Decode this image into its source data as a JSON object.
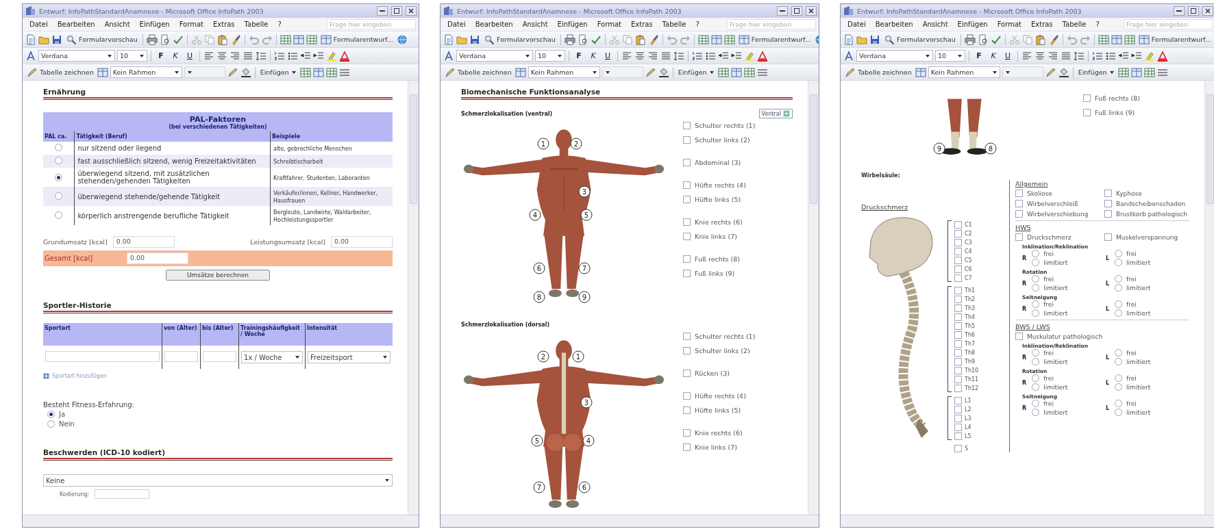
{
  "windows": [
    {
      "title": "Entwurf: InfoPathStandardAnamnese - Microsoft Office InfoPath 2003",
      "menus": [
        "Datei",
        "Bearbeiten",
        "Ansicht",
        "Einfügen",
        "Format",
        "Extras",
        "Tabelle",
        "?"
      ],
      "help_placeholder": "Frage hier eingeben",
      "toolbar": {
        "preview": "Formularvorschau",
        "design": "Formularentwurf...",
        "font": "Verdana",
        "size": "10",
        "format_buttons": [
          "F",
          "K",
          "U"
        ],
        "draw_table": "Tabelle zeichnen",
        "border": "Kein Rahmen",
        "insert": "Einfügen"
      },
      "content": [
        {
          "kind": "heading",
          "text": "Ernährung"
        },
        {
          "kind": "pal_table",
          "title": "PAL-Faktoren",
          "subtitle": "(bei verschiedenen Tätigkeiten)",
          "columns": [
            "PAL ca.",
            "Tätigkeit (Beruf)",
            "Beispiele"
          ],
          "rows": [
            {
              "activity": "nur sitzend oder liegend",
              "examples": "alte, gebrechliche Menschen",
              "selected": false
            },
            {
              "activity": "fast ausschließlich sitzend, wenig Freizeitaktivitäten",
              "examples": "Schreibtischarbeit",
              "selected": false
            },
            {
              "activity": "überwiegend sitzend, mit zusätzlichen stehenden/gehenden Tätigkeiten",
              "examples": "Kraftfahrer, Studenten, Laboranten",
              "selected": true
            },
            {
              "activity": "überwiegend stehende/gehende Tätigkeit",
              "examples": "Verkäufer/innen, Kellner, Handwerker, Hausfrauen",
              "selected": false
            },
            {
              "activity": "körperlich anstrengende berufliche Tätigkeit",
              "examples": "Bergleute, Landwirte, Waldarbeiter, Hochleistungssportler",
              "selected": false
            }
          ]
        },
        {
          "kind": "energy",
          "fields": [
            {
              "label": "Grundumsatz [kcal]",
              "value": "0.00"
            },
            {
              "label": "Leistungsumsatz [kcal]",
              "value": "0.00"
            }
          ],
          "total": {
            "label": "Gesamt [kcal]",
            "value": "0.00"
          },
          "button": "Umsätze berechnen"
        },
        {
          "kind": "heading",
          "text": "Sportler-Historie"
        },
        {
          "kind": "sport_table",
          "columns": [
            "Sportart",
            "von (Alter)",
            "bis (Alter)",
            "Trainingshäufigkeit / Woche",
            "Intensität"
          ],
          "row": {
            "frequency": "1x / Woche",
            "intensity": "Freizeitsport"
          },
          "add_link": "Sportart hinzufügen"
        },
        {
          "kind": "radio_group",
          "label": "Besteht Fitness-Erfahrung:",
          "options": [
            {
              "label": "Ja",
              "selected": true
            },
            {
              "label": "Nein",
              "selected": false
            }
          ]
        },
        {
          "kind": "heading",
          "text": "Beschwerden (ICD-10 kodiert)"
        },
        {
          "kind": "select_block",
          "value": "Keine",
          "code_label": "Kodierung:"
        }
      ]
    },
    {
      "title": "Entwurf: InfoPathStandardAnamnese - Microsoft Office InfoPath 2003",
      "menus": [
        "Datei",
        "Bearbeiten",
        "Ansicht",
        "Einfügen",
        "Format",
        "Extras",
        "Tabelle",
        "?"
      ],
      "help_placeholder": "Frage hier eingeben",
      "toolbar": {
        "preview": "Formularvorschau",
        "design": "Formularentwurf...",
        "font": "Verdana",
        "size": "10",
        "format_buttons": [
          "F",
          "K",
          "U"
        ],
        "draw_table": "Tabelle zeichnen",
        "border": "Kein Rahmen",
        "insert": "Einfügen"
      },
      "content": [
        {
          "kind": "heading",
          "text": "Biomechanische Funktionsanalyse"
        },
        {
          "kind": "figure_front",
          "title": "Schmerzlokalisation (ventral)",
          "selector": "Ventral",
          "markers": [
            "1",
            "2",
            "3",
            "4",
            "5",
            "6",
            "7",
            "8",
            "9"
          ],
          "groups": [
            {
              "items": [
                {
                  "label": "Schulter rechts (1)",
                  "checked": false
                },
                {
                  "label": "Schulter links (2)",
                  "checked": false
                }
              ]
            },
            {
              "items": [
                {
                  "label": "Abdominal (3)",
                  "checked": false
                }
              ]
            },
            {
              "items": [
                {
                  "label": "Hüfte rechts (4)",
                  "checked": false
                },
                {
                  "label": "Hüfte links (5)",
                  "checked": false
                }
              ]
            },
            {
              "items": [
                {
                  "label": "Knie rechts (6)",
                  "checked": false
                },
                {
                  "label": "Knie links (7)",
                  "checked": false
                }
              ]
            },
            {
              "items": [
                {
                  "label": "Fuß rechts (8)",
                  "checked": false
                },
                {
                  "label": "Fuß links (9)",
                  "checked": false
                }
              ]
            }
          ]
        },
        {
          "kind": "figure_back",
          "title": "Schmerzlokalisation (dorsal)",
          "markers": [
            "2",
            "1",
            "3",
            "5",
            "4",
            "7",
            "6"
          ],
          "groups": [
            {
              "items": [
                {
                  "label": "Schulter rechts (1)",
                  "checked": false
                },
                {
                  "label": "Schulter links (2)",
                  "checked": false
                }
              ]
            },
            {
              "items": [
                {
                  "label": "Rücken (3)",
                  "checked": false
                }
              ]
            },
            {
              "items": [
                {
                  "label": "Hüfte rechts (4)",
                  "checked": false
                },
                {
                  "label": "Hüfte links (5)",
                  "checked": false
                }
              ]
            },
            {
              "items": [
                {
                  "label": "Knie rechts (6)",
                  "checked": false
                },
                {
                  "label": "Knie links (7)",
                  "checked": false
                }
              ]
            }
          ]
        }
      ]
    },
    {
      "title": "Entwurf: InfoPathStandardAnamnese - Microsoft Office InfoPath 2003",
      "menus": [
        "Datei",
        "Bearbeiten",
        "Ansicht",
        "Einfügen",
        "Format",
        "Extras",
        "Tabelle",
        "?"
      ],
      "help_placeholder": "Frage hier eingeben",
      "toolbar": {
        "preview": "Formularvorschau",
        "design": "Formularentwurf...",
        "font": "Verdana",
        "size": "10",
        "format_buttons": [
          "F",
          "K",
          "U"
        ],
        "draw_table": "Tabelle zeichnen",
        "border": "Kein Rahmen",
        "insert": "Einfügen"
      },
      "content": [
        {
          "kind": "figure_legs",
          "markers": [
            "9",
            "8"
          ],
          "groups": [
            {
              "items": [
                {
                  "label": "Fuß rechts (8)",
                  "checked": false
                },
                {
                  "label": "Fuß links (9)",
                  "checked": false
                }
              ]
            }
          ]
        },
        {
          "kind": "spine",
          "label": "Wirbelsäule:",
          "pressure_title": "Druckschmerz",
          "segment_groups": [
            {
              "items": [
                {
                  "label": "C1",
                  "checked": false
                },
                {
                  "label": "C2",
                  "checked": false
                },
                {
                  "label": "C3",
                  "checked": false
                },
                {
                  "label": "C4",
                  "checked": false
                },
                {
                  "label": "C5",
                  "checked": false
                },
                {
                  "label": "C6",
                  "checked": false
                },
                {
                  "label": "C7",
                  "checked": false
                }
              ]
            },
            {
              "items": [
                {
                  "label": "Th1",
                  "checked": false
                },
                {
                  "label": "Th2",
                  "checked": false
                },
                {
                  "label": "Th3",
                  "checked": false
                },
                {
                  "label": "Th4",
                  "checked": false
                },
                {
                  "label": "Th5",
                  "checked": false
                },
                {
                  "label": "Th6",
                  "checked": false
                },
                {
                  "label": "Th7",
                  "checked": false
                },
                {
                  "label": "Th8",
                  "checked": false
                },
                {
                  "label": "Th9",
                  "checked": false
                },
                {
                  "label": "Th10",
                  "checked": false
                },
                {
                  "label": "Th11",
                  "checked": false
                },
                {
                  "label": "Th12",
                  "checked": false
                }
              ]
            },
            {
              "items": [
                {
                  "label": "L1",
                  "checked": false
                },
                {
                  "label": "L2",
                  "checked": false
                },
                {
                  "label": "L3",
                  "checked": false
                },
                {
                  "label": "L4",
                  "checked": false
                },
                {
                  "label": "L5",
                  "checked": false
                }
              ]
            },
            {
              "items": [
                {
                  "label": "S",
                  "checked": false
                }
              ]
            }
          ],
          "general_title": "Allgemein",
          "general": [
            {
              "label": "Skoliose",
              "checked": false
            },
            {
              "label": "Kyphose",
              "checked": false
            },
            {
              "label": "Wirbelverschleiß",
              "checked": false
            },
            {
              "label": "Bandscheibenschaden",
              "checked": false
            },
            {
              "label": "Wirbelverschiebung",
              "checked": false
            },
            {
              "label": "Brustkorb pathologisch",
              "checked": false
            }
          ],
          "regions": [
            {
              "title": "HWS",
              "checkboxes": [
                {
                  "label": "Druckschmerz",
                  "checked": false
                },
                {
                  "label": "Muskelverspannung",
                  "checked": false
                }
              ],
              "motions": [
                {
                  "title": "Inklination/Reklination",
                  "sides": [
                    {
                      "label": "R",
                      "options": [
                        {
                          "label": "frei",
                          "selected": false
                        },
                        {
                          "label": "limitiert",
                          "selected": false
                        }
                      ]
                    },
                    {
                      "label": "L",
                      "options": [
                        {
                          "label": "frei",
                          "selected": false
                        },
                        {
                          "label": "limitiert",
                          "selected": false
                        }
                      ]
                    }
                  ]
                },
                {
                  "title": "Rotation",
                  "sides": [
                    {
                      "label": "R",
                      "options": [
                        {
                          "label": "frei",
                          "selected": false
                        },
                        {
                          "label": "limitiert",
                          "selected": false
                        }
                      ]
                    },
                    {
                      "label": "L",
                      "options": [
                        {
                          "label": "frei",
                          "selected": false
                        },
                        {
                          "label": "limitiert",
                          "selected": false
                        }
                      ]
                    }
                  ]
                },
                {
                  "title": "Seitneigung",
                  "sides": [
                    {
                      "label": "R",
                      "options": [
                        {
                          "label": "frei",
                          "selected": false
                        },
                        {
                          "label": "limitiert",
                          "selected": false
                        }
                      ]
                    },
                    {
                      "label": "L",
                      "options": [
                        {
                          "label": "frei",
                          "selected": false
                        },
                        {
                          "label": "limitiert",
                          "selected": false
                        }
                      ]
                    }
                  ]
                }
              ]
            },
            {
              "title": "BWS / LWS",
              "checkboxes": [
                {
                  "label": "Muskulatur pathologisch",
                  "checked": false
                }
              ],
              "motions": [
                {
                  "title": "Inklination/Reklination",
                  "sides": [
                    {
                      "label": "R",
                      "options": [
                        {
                          "label": "frei",
                          "selected": false
                        },
                        {
                          "label": "limitiert",
                          "selected": false
                        }
                      ]
                    },
                    {
                      "label": "L",
                      "options": [
                        {
                          "label": "frei",
                          "selected": false
                        },
                        {
                          "label": "limitiert",
                          "selected": false
                        }
                      ]
                    }
                  ]
                },
                {
                  "title": "Rotation",
                  "sides": [
                    {
                      "label": "R",
                      "options": [
                        {
                          "label": "frei",
                          "selected": false
                        },
                        {
                          "label": "limitiert",
                          "selected": false
                        }
                      ]
                    },
                    {
                      "label": "L",
                      "options": [
                        {
                          "label": "frei",
                          "selected": false
                        },
                        {
                          "label": "limitiert",
                          "selected": false
                        }
                      ]
                    }
                  ]
                },
                {
                  "title": "Seitneigung",
                  "sides": [
                    {
                      "label": "R",
                      "options": [
                        {
                          "label": "frei",
                          "selected": false
                        },
                        {
                          "label": "limitiert",
                          "selected": false
                        }
                      ]
                    },
                    {
                      "label": "L",
                      "options": [
                        {
                          "label": "frei",
                          "selected": false
                        },
                        {
                          "label": "limitiert",
                          "selected": false
                        }
                      ]
                    }
                  ]
                }
              ]
            }
          ]
        }
      ]
    }
  ]
}
